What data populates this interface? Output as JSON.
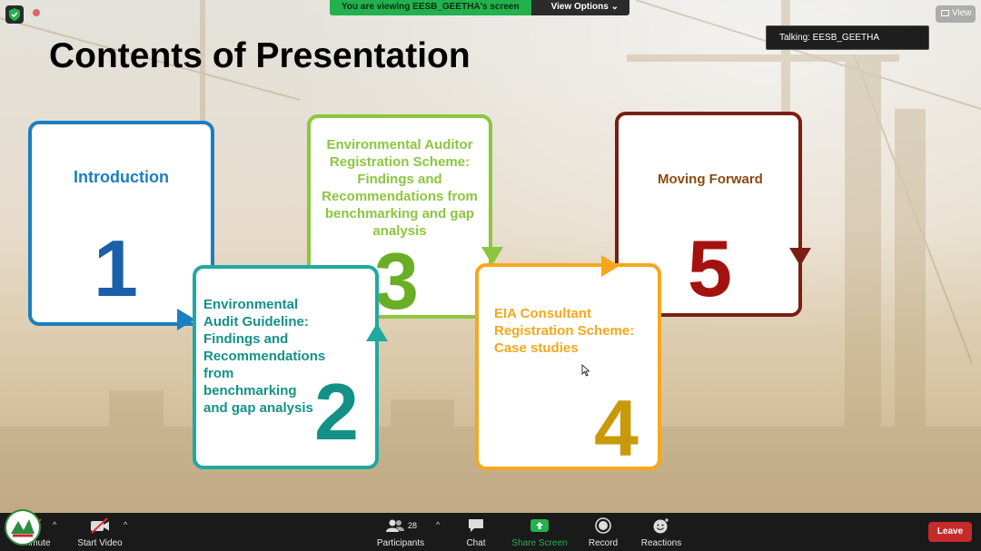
{
  "share_banner": {
    "viewing_text": "You are viewing EESB_GEETHA's screen",
    "options_label": "View Options",
    "options_caret": "⌄"
  },
  "top_left": {
    "recording_label": "Recording"
  },
  "talking": {
    "text": "Talking: EESB_GEETHA"
  },
  "view_button": {
    "label": "View"
  },
  "slide": {
    "title": "Contents of Presentation",
    "items": [
      {
        "number": "1",
        "label": "Introduction",
        "color": "#1a7fc1",
        "number_color": "#1a5fa8"
      },
      {
        "number": "2",
        "label": [
          "Environmental",
          "Audit Guideline:",
          "Findings and",
          "Recommendations",
          "from",
          "benchmarking",
          "and gap analysis"
        ],
        "color": "#1fa9a0",
        "number_color": "#139187"
      },
      {
        "number": "3",
        "label": [
          "Environmental Auditor",
          "Registration Scheme:",
          "Findings and",
          "Recommendations from",
          "benchmarking and gap",
          "analysis"
        ],
        "color": "#8cc63f",
        "number_color": "#6aae26"
      },
      {
        "number": "4",
        "label": [
          "EIA Consultant",
          "Registration Scheme:",
          "Case studies"
        ],
        "color": "#f5a81c",
        "number_color": "#c89a0a"
      },
      {
        "number": "5",
        "label": "Moving Forward",
        "color": "#7a1f14",
        "number_color": "#a3120f",
        "label_color": "#8a4a10"
      }
    ]
  },
  "toolbar": {
    "unmute_label": "Unmute",
    "start_video_label": "Start Video",
    "participants_label": "Participants",
    "participants_count": "28",
    "chat_label": "Chat",
    "share_label": "Share Screen",
    "record_label": "Record",
    "reactions_label": "Reactions",
    "leave_label": "Leave",
    "caret": "^"
  },
  "colors": {
    "share_green": "#22b14c",
    "leave_red": "#c62a2a",
    "toolbar_bg": "#1a1a1a"
  }
}
